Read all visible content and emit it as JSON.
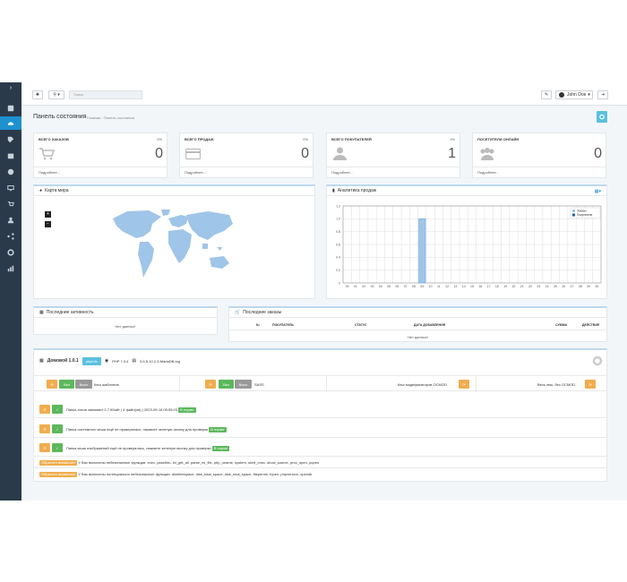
{
  "header": {
    "search_placeholder": "Поиск",
    "user_name": "John Doe"
  },
  "page": {
    "title": "Панель состояния",
    "breadcrumb": [
      "Главная",
      "Панель состояния"
    ]
  },
  "tiles": [
    {
      "title": "ВСЕГО ЗАКАЗОВ",
      "percent": "0%",
      "value": "0",
      "link": "Подробнее..."
    },
    {
      "title": "ВСЕГО ПРОДАЖ",
      "percent": "0%",
      "value": "0",
      "link": "Подробнее..."
    },
    {
      "title": "ВСЕГО ПОКУПАТЕЛЕЙ",
      "percent": "0%",
      "value": "1",
      "link": "Подробнее..."
    },
    {
      "title": "ПОСЕТИТЕЛИ ОНЛАЙН",
      "percent": "",
      "value": "0",
      "link": "Подробнее..."
    }
  ],
  "map_panel": {
    "title": "Карта мира",
    "zoom_in": "+",
    "zoom_out": "−"
  },
  "sales_panel": {
    "title": "Аналитика продаж"
  },
  "chart_data": {
    "type": "bar",
    "categories": [
      "00",
      "01",
      "02",
      "03",
      "04",
      "05",
      "06",
      "07",
      "08",
      "09",
      "10",
      "11",
      "12",
      "13",
      "14",
      "15",
      "16",
      "17",
      "18",
      "19",
      "20",
      "21",
      "22",
      "23",
      "24",
      "25",
      "26",
      "27",
      "28",
      "29",
      "30"
    ],
    "series": [
      {
        "name": "Заказы",
        "values": [
          0,
          0,
          0,
          0,
          0,
          0,
          0,
          0,
          0,
          0,
          0,
          0,
          0,
          0,
          0,
          0,
          0,
          0,
          0,
          0,
          0,
          0,
          0,
          0,
          0,
          0,
          0,
          0,
          0,
          0,
          0
        ]
      },
      {
        "name": "Покупатели",
        "values": [
          0,
          0,
          0,
          0,
          0,
          0,
          0,
          0,
          0,
          1,
          0,
          0,
          0,
          0,
          0,
          0,
          0,
          0,
          0,
          0,
          0,
          0,
          0,
          0,
          0,
          0,
          0,
          0,
          0,
          0,
          0
        ]
      }
    ],
    "y_ticks": [
      "0",
      "0.2",
      "0.4",
      "0.6",
      "0.8",
      "1.0",
      "1.2"
    ],
    "ylim": [
      0,
      1.2
    ],
    "colors": {
      "Заказы": "#9fc5e8",
      "Покупатели": "#1f5fb0"
    },
    "legend": "top-right",
    "grid": true
  },
  "activity_panel": {
    "title": "Последние активность",
    "empty": "Нет данных!"
  },
  "orders_panel": {
    "title": "Последние заказы",
    "columns": [
      "№",
      "ПОКУПАТЕЛЬ",
      "СТАТУС",
      "ДАТА ДОБАВЛЕНИЯ",
      "СУММА",
      "ДЕЙСТВИЕ"
    ],
    "empty": "Нет данных!"
  },
  "tools": {
    "title": "Домовой 1.0.1",
    "tag": "phpinfo",
    "php": "PHP 7.3.4",
    "db": "5.5.5-10.2.3-MariaDB-log",
    "on_label": "Вкл",
    "off_label": "Выкл",
    "twig_cache": "Кеш шаблонов",
    "sass": "SASS",
    "ocmod_cache": "Кеш модификаторов OCMOD",
    "all_cache": "Весь кеш, без OCMOD",
    "rows": [
      {
        "text": "Папка логов занимает 2.7 Кбайт | 4 файл(ов) | 2023-09-18 05:55:03",
        "badge": "В норме"
      },
      {
        "text": "Папка системного кеша ещё не проверялась, нажмите зеленую иконку для проверки",
        "badge": "В норме"
      },
      {
        "text": "Папка кеша изображений ещё не проверялась, нажмите зеленую иконку для проверки",
        "badge": "В норме"
      }
    ],
    "warnings": [
      {
        "label": "Обратите внимание!",
        "text": "У Вас включены небезопасные функции: exec, passthru, ini_get_all, parse_ini_file, php_uname, system, shell_exec, show_source, proc_open, popen"
      },
      {
        "label": "Обратите внимание!",
        "text": "У Вас включены потенциально небезопасные функции: diskfreespace, disk_total_space, disk_total_space, fileperms, fopen, phpversion, opendir"
      }
    ]
  }
}
